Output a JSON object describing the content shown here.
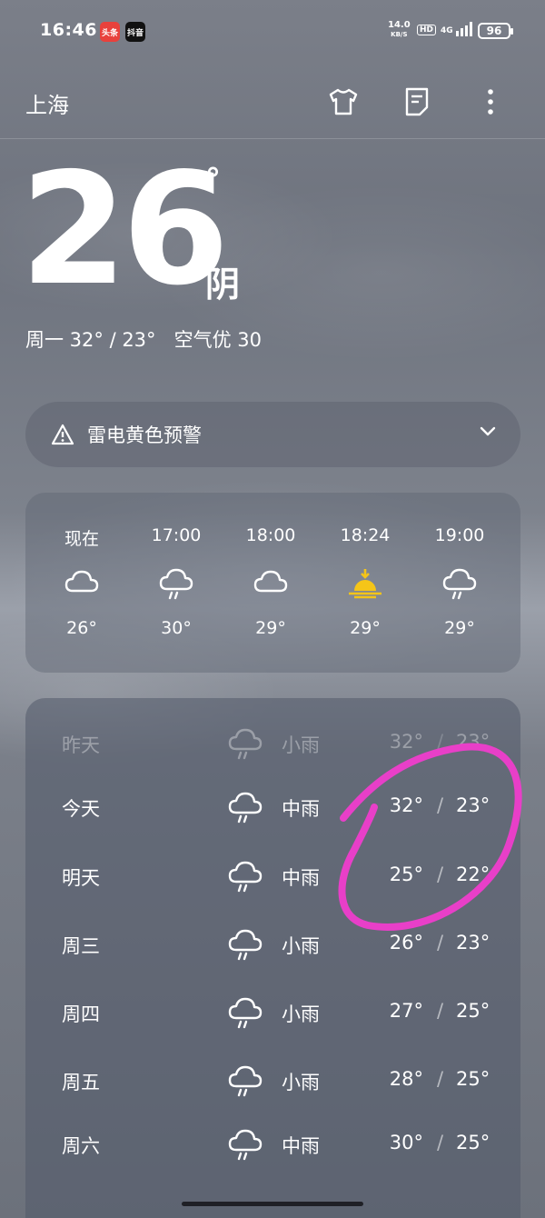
{
  "status_bar": {
    "time": "16:46",
    "apps": [
      "头条",
      "抖音"
    ],
    "net_speed_value": "14.0",
    "net_speed_unit": "KB/S",
    "hd": "HD",
    "signal": "4G",
    "battery": "96"
  },
  "header": {
    "city": "上海",
    "icons": [
      "shirt-icon",
      "note-icon",
      "more-icon"
    ]
  },
  "current": {
    "temp": "26",
    "degree_symbol": "°",
    "condition": "阴",
    "summary": "周一 32° / 23°   空气优 30"
  },
  "alert": {
    "text": "雷电黄色预警",
    "icon": "warning-icon"
  },
  "hourly": [
    {
      "time": "现在",
      "icon": "cloud-icon",
      "temp": "26°"
    },
    {
      "time": "17:00",
      "icon": "rain-cloud-icon",
      "temp": "30°"
    },
    {
      "time": "18:00",
      "icon": "cloud-icon",
      "temp": "29°"
    },
    {
      "time": "18:24",
      "icon": "sunset-icon",
      "temp": "29°"
    },
    {
      "time": "19:00",
      "icon": "rain-cloud-icon",
      "temp": "29°"
    }
  ],
  "daily": [
    {
      "day": "昨天",
      "icon": "rain-cloud-icon",
      "condition": "小雨",
      "high": "32°",
      "low": "23°",
      "faded": true
    },
    {
      "day": "今天",
      "icon": "rain-cloud-icon",
      "condition": "中雨",
      "high": "32°",
      "low": "23°"
    },
    {
      "day": "明天",
      "icon": "rain-cloud-icon",
      "condition": "中雨",
      "high": "25°",
      "low": "22°"
    },
    {
      "day": "周三",
      "icon": "rain-cloud-icon",
      "condition": "小雨",
      "high": "26°",
      "low": "23°"
    },
    {
      "day": "周四",
      "icon": "rain-cloud-icon",
      "condition": "小雨",
      "high": "27°",
      "low": "25°"
    },
    {
      "day": "周五",
      "icon": "rain-cloud-icon",
      "condition": "小雨",
      "high": "28°",
      "low": "25°"
    },
    {
      "day": "周六",
      "icon": "rain-cloud-icon",
      "condition": "中雨",
      "high": "30°",
      "low": "25°"
    }
  ],
  "colors": {
    "sunset_icon": "#f5c518",
    "annotation": "#e83fc8",
    "toutiao_badge": "#e8413c"
  }
}
